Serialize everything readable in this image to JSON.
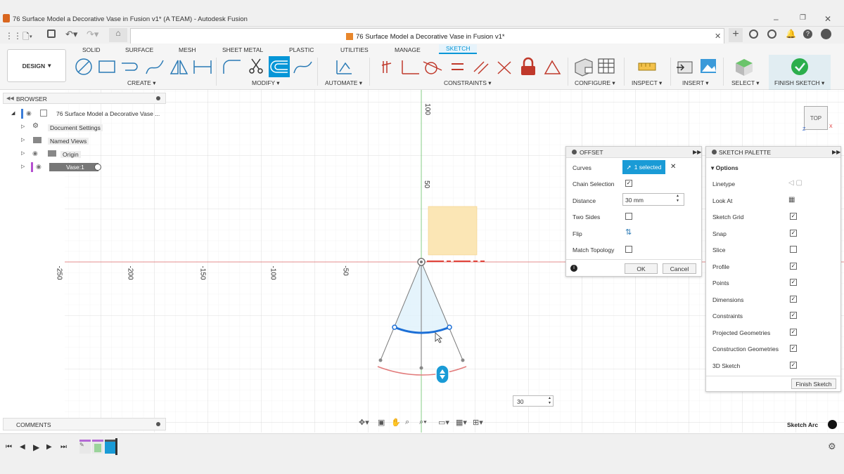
{
  "window": {
    "title": "76 Surface Model a Decorative Vase in Fusion v1* (A TEAM) - Autodesk Fusion",
    "doc_tab": "76 Surface Model a Decorative Vase in Fusion v1*",
    "controls": [
      "–",
      "❐",
      "✕"
    ]
  },
  "ribbon": {
    "workspace": "DESIGN",
    "tabs": [
      "SOLID",
      "SURFACE",
      "MESH",
      "SHEET METAL",
      "PLASTIC",
      "UTILITIES",
      "MANAGE",
      "SKETCH"
    ],
    "active_tab": "SKETCH",
    "groups": [
      "CREATE ▾",
      "MODIFY ▾",
      "AUTOMATE ▾",
      "CONSTRAINTS ▾",
      "CONFIGURE ▾",
      "INSPECT ▾",
      "INSERT ▾",
      "SELECT ▾",
      "FINISH SKETCH ▾"
    ],
    "accent": "#0696d7"
  },
  "browser": {
    "title": "BROWSER",
    "items": [
      {
        "label": "76 Surface Model a Decorative Vase ..."
      },
      {
        "label": "Document Settings"
      },
      {
        "label": "Named Views"
      },
      {
        "label": "Origin"
      },
      {
        "label": "Vase:1"
      }
    ]
  },
  "comments": {
    "title": "COMMENTS"
  },
  "axes": {
    "x_ticks": [
      "-250",
      "-200",
      "-150",
      "-100",
      "-50"
    ],
    "y_ticks": [
      "100",
      "50"
    ]
  },
  "viewcube": {
    "face": "TOP",
    "x": "X",
    "z": "Z"
  },
  "offset": {
    "title": "OFFSET",
    "curves_label": "Curves",
    "curves_value": "1 selected",
    "chain_label": "Chain Selection",
    "chain_checked": true,
    "distance_label": "Distance",
    "distance_value": "30 mm",
    "two_sides_label": "Two Sides",
    "two_sides_checked": false,
    "flip_label": "Flip",
    "match_label": "Match Topology",
    "match_checked": false,
    "ok": "OK",
    "cancel": "Cancel"
  },
  "palette": {
    "title": "SKETCH PALETTE",
    "section": "Options",
    "rows": [
      {
        "label": "Linetype",
        "checked": null
      },
      {
        "label": "Look At",
        "checked": null
      },
      {
        "label": "Sketch Grid",
        "checked": true
      },
      {
        "label": "Snap",
        "checked": true
      },
      {
        "label": "Slice",
        "checked": false
      },
      {
        "label": "Profile",
        "checked": true
      },
      {
        "label": "Points",
        "checked": true
      },
      {
        "label": "Dimensions",
        "checked": true
      },
      {
        "label": "Constraints",
        "checked": true
      },
      {
        "label": "Projected Geometries",
        "checked": true
      },
      {
        "label": "Construction Geometries",
        "checked": true
      },
      {
        "label": "3D Sketch",
        "checked": true
      }
    ],
    "finish": "Finish Sketch"
  },
  "canvas_input": {
    "value": "30"
  },
  "status": {
    "text": "Sketch Arc"
  }
}
